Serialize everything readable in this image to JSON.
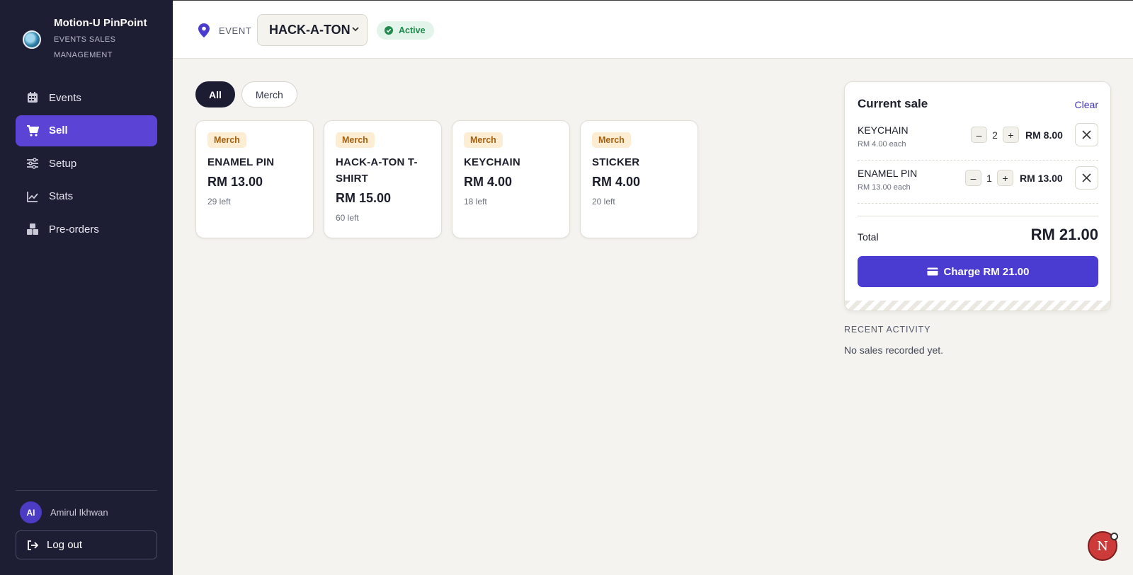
{
  "app": {
    "name": "Motion-U PinPoint",
    "subtitle_line1": "EVENTS SALES",
    "subtitle_line2": "MANAGEMENT"
  },
  "sidebar": {
    "items": [
      {
        "label": "Events",
        "icon": "calendar-icon"
      },
      {
        "label": "Sell",
        "icon": "cart-icon",
        "active": true
      },
      {
        "label": "Setup",
        "icon": "sliders-icon"
      },
      {
        "label": "Stats",
        "icon": "chart-line-icon"
      },
      {
        "label": "Pre-orders",
        "icon": "boxes-icon"
      }
    ],
    "user": {
      "initials": "AI",
      "name": "Amirul Ikhwan"
    },
    "logout_label": "Log out"
  },
  "header": {
    "event_label": "EVENT",
    "event_selected": "HACK-A-TON",
    "status": "Active"
  },
  "filters": [
    {
      "label": "All",
      "active": true
    },
    {
      "label": "Merch",
      "active": false
    }
  ],
  "products": [
    {
      "tag": "Merch",
      "name": "ENAMEL PIN",
      "price": "RM 13.00",
      "stock": "29 left"
    },
    {
      "tag": "Merch",
      "name": "HACK-A-TON T-SHIRT",
      "price": "RM 15.00",
      "stock": "60 left"
    },
    {
      "tag": "Merch",
      "name": "KEYCHAIN",
      "price": "RM 4.00",
      "stock": "18 left"
    },
    {
      "tag": "Merch",
      "name": "STICKER",
      "price": "RM 4.00",
      "stock": "20 left"
    }
  ],
  "sale": {
    "title": "Current sale",
    "clear_label": "Clear",
    "lines": [
      {
        "name": "KEYCHAIN",
        "each": "RM 4.00 each",
        "qty": "2",
        "minus": "–",
        "plus": "+",
        "total": "RM 8.00"
      },
      {
        "name": "ENAMEL PIN",
        "each": "RM 13.00 each",
        "qty": "1",
        "minus": "–",
        "plus": "+",
        "total": "RM 13.00"
      }
    ],
    "total_label": "Total",
    "total_value": "RM 21.00",
    "charge_label": "Charge RM 21.00"
  },
  "recent": {
    "title": "RECENT ACTIVITY",
    "empty": "No sales recorded yet."
  },
  "fab": {
    "letter": "N"
  },
  "colors": {
    "sidebar_bg": "#1d1d33",
    "accent": "#5b43d6",
    "charge": "#4a3bd1",
    "background": "#f4f3ef",
    "status_green": "#1f8a4c",
    "tag_orange": "#a5600f"
  }
}
